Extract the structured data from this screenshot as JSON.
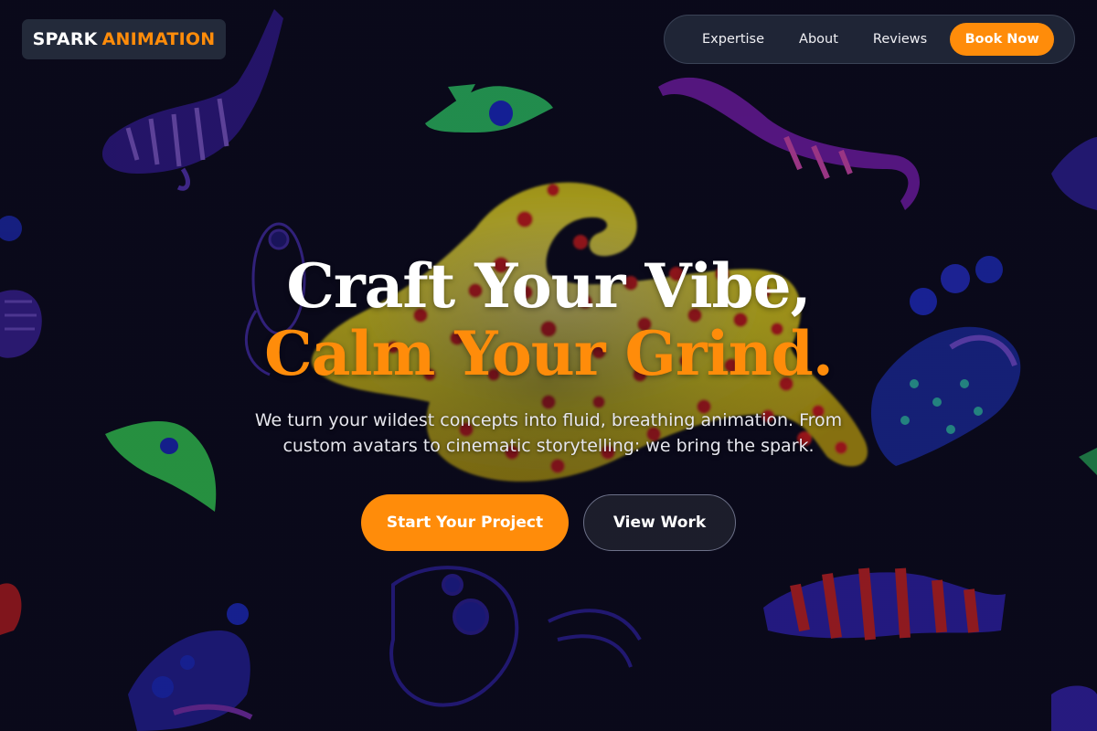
{
  "brand": {
    "word1": "SPARK",
    "word2": "ANIMATION"
  },
  "nav": {
    "links": [
      {
        "label": "Expertise"
      },
      {
        "label": "About"
      },
      {
        "label": "Reviews"
      }
    ],
    "cta_label": "Book Now"
  },
  "hero": {
    "title_line1": "Craft Your Vibe,",
    "title_line2": "Calm Your Grind.",
    "subtitle": "We turn your wildest concepts into fluid, breathing animation. From custom avatars to cinematic storytelling: we bring the spark.",
    "primary_button": "Start Your Project",
    "secondary_button": "View Work"
  },
  "colors": {
    "accent": "#ff8c0a",
    "background": "#0b0a1c",
    "nav_bg": "#222838",
    "logo_bg": "#232a3a"
  },
  "background_image": {
    "subject": "neon-doodle-creatures",
    "centerpiece": "yellow-polka-dot-sculpture"
  }
}
